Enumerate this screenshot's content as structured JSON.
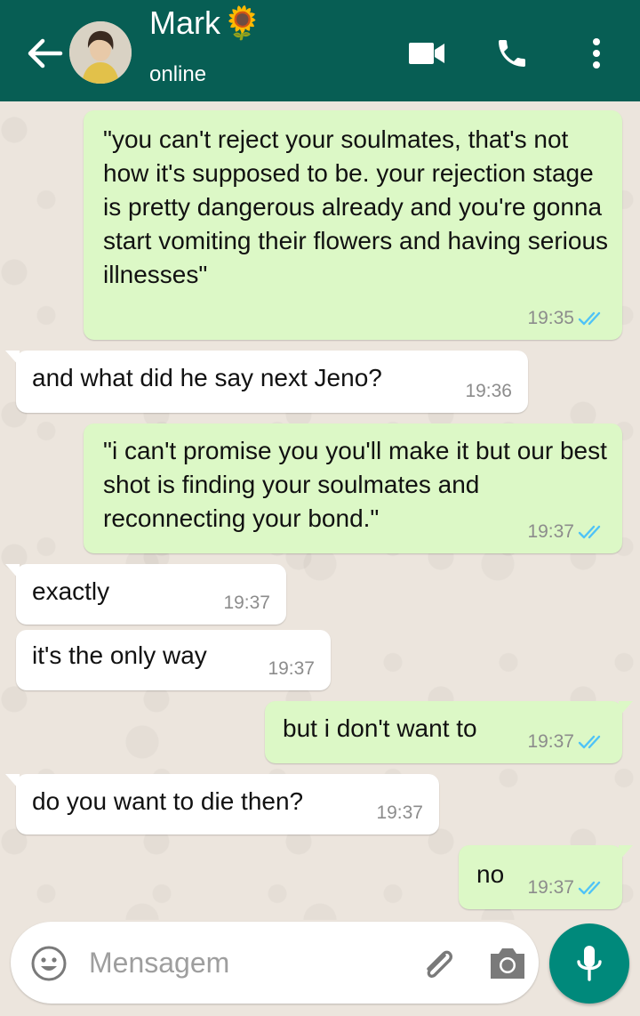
{
  "header": {
    "contact_name": "Mark",
    "name_emoji": "🌻",
    "status": "online",
    "icons": [
      "back-arrow-icon",
      "video-camera-icon",
      "phone-icon",
      "more-vert-icon"
    ],
    "color": "#075e54"
  },
  "messages": [
    {
      "direction": "out",
      "text": "\"you can't reject your soulmates, that's not how it's supposed to be. your rejection stage is pretty dangerous already and you're gonna start vomiting their flowers and having serious illnesses\"",
      "time": "19:35",
      "read": true
    },
    {
      "direction": "in",
      "text": "and what did he say next Jeno?",
      "time": "19:36"
    },
    {
      "direction": "out",
      "text": "\"i can't promise you you'll make it but our best shot is finding your soulmates and reconnecting your bond.\"",
      "time": "19:37",
      "read": true
    },
    {
      "direction": "in",
      "text": "exactly",
      "time": "19:37"
    },
    {
      "direction": "in",
      "text": "it's the only way",
      "time": "19:37"
    },
    {
      "direction": "out",
      "text": "but i don't want to",
      "time": "19:37",
      "read": true
    },
    {
      "direction": "in",
      "text": "do you want to die then?",
      "time": "19:37"
    },
    {
      "direction": "out",
      "text": "no",
      "time": "19:37",
      "read": true
    }
  ],
  "composer": {
    "placeholder": "Mensagem",
    "value": "",
    "icons": [
      "emoji-icon",
      "paperclip-icon",
      "camera-icon",
      "mic-icon"
    ]
  },
  "colors": {
    "outgoing_bubble": "#dcf8c6",
    "incoming_bubble": "#ffffff",
    "read_ticks": "#4fc3f7",
    "mic_button": "#00897b"
  }
}
